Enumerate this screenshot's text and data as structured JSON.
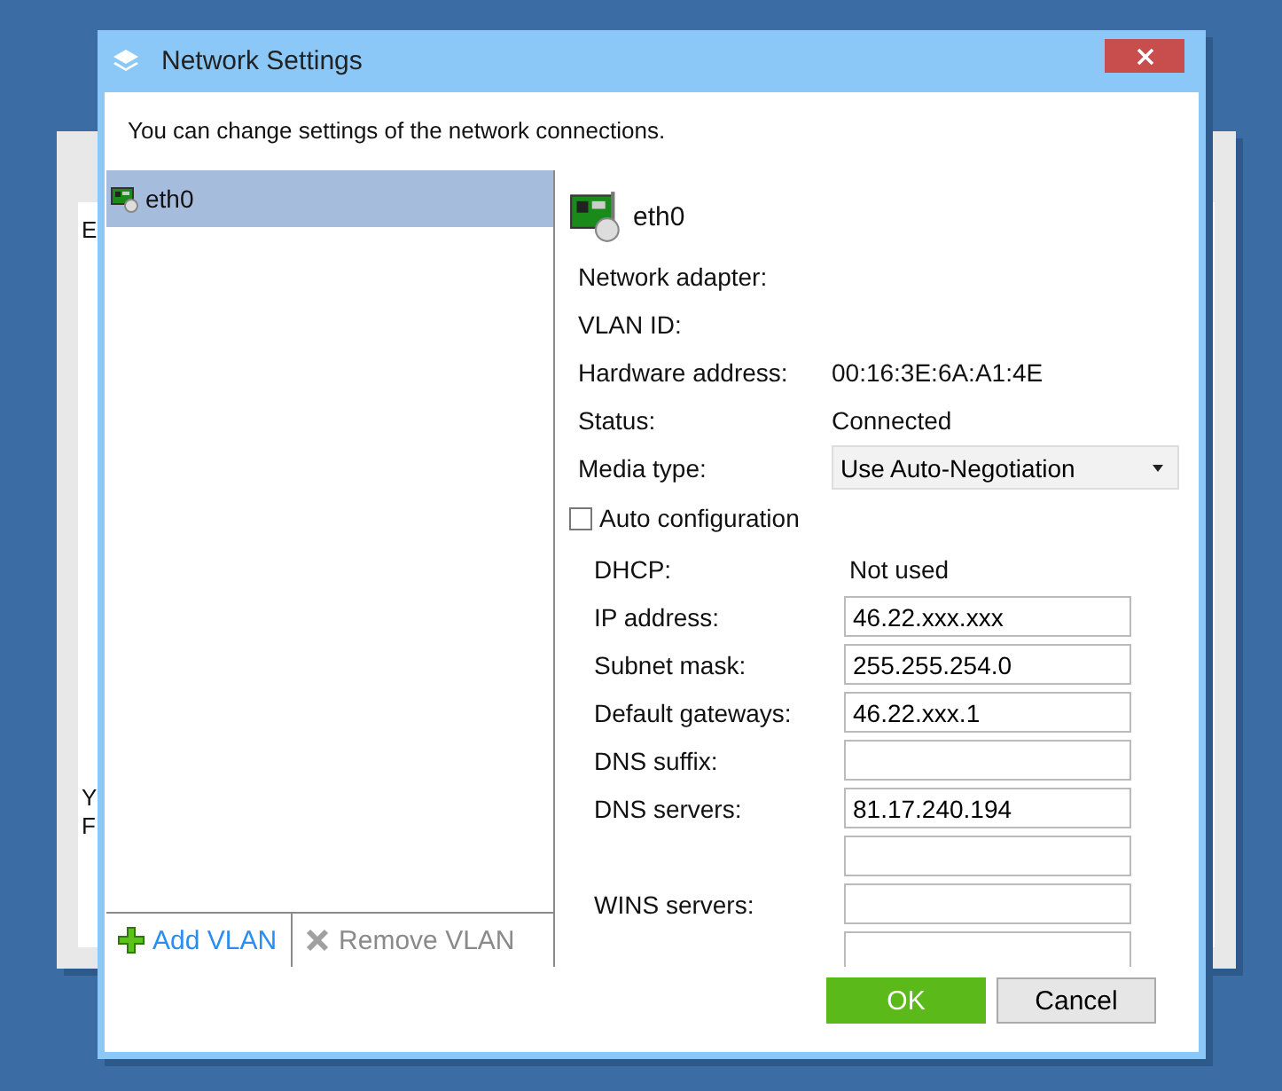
{
  "background_window": {
    "texts": [
      "E",
      "Y",
      "F"
    ]
  },
  "window": {
    "title": "Network Settings",
    "intro": "You can change settings of the network connections."
  },
  "adapters": [
    {
      "name": "eth0",
      "selected": true
    }
  ],
  "list_toolbar": [
    {
      "label": "Add VLAN",
      "kind": "add",
      "disabled": false
    },
    {
      "label": "Remove VLAN",
      "kind": "remove",
      "disabled": true
    }
  ],
  "details": {
    "name": "eth0",
    "info": [
      {
        "label": "Network adapter:"
      },
      {
        "label": "VLAN ID:"
      },
      {
        "label": "Hardware address:",
        "value": "00:16:3E:6A:A1:4E"
      },
      {
        "label": "Status:",
        "value": "Connected"
      }
    ],
    "media_type": {
      "label": "Media type:",
      "value": "Use Auto-Negotiation"
    },
    "auto_configuration": {
      "label": "Auto configuration",
      "checked": false
    },
    "fields": [
      {
        "label": "DHCP:",
        "kind": "text",
        "value": "Not used"
      },
      {
        "label": "IP address:",
        "kind": "input",
        "value": "46.22.xxx.xxx"
      },
      {
        "label": "Subnet mask:",
        "kind": "input",
        "value": "255.255.254.0"
      },
      {
        "label": "Default gateways:",
        "kind": "input",
        "value": "46.22.xxx.1"
      },
      {
        "label": "DNS suffix:",
        "kind": "input"
      },
      {
        "label": "DNS servers:",
        "kind": "input",
        "value": "81.17.240.194"
      },
      {
        "kind": "input"
      },
      {
        "label": "WINS servers:",
        "kind": "input"
      },
      {
        "kind": "input"
      }
    ]
  },
  "buttons": [
    {
      "label": "OK",
      "kind": "primary"
    },
    {
      "label": "Cancel",
      "kind": "secondary"
    }
  ]
}
